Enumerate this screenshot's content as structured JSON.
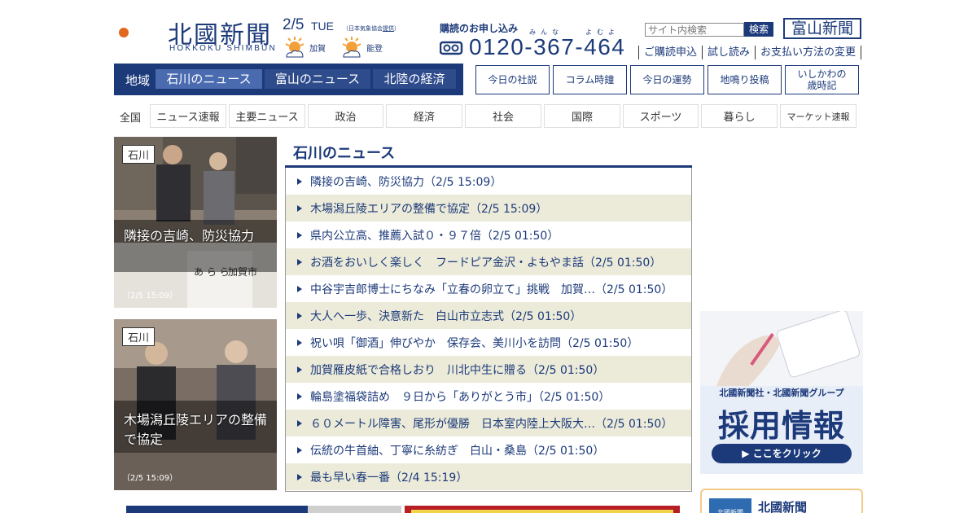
{
  "header": {
    "logo_text": "北國新聞",
    "logo_sub": "HOKKOKU SHIMBUN",
    "date": "2/5",
    "dow": "TUE",
    "weather_source_prefix": "（日本気象協会",
    "weather_source_link": "提供",
    "weather_source_suffix": "）",
    "weather": [
      {
        "area": "加賀",
        "icon": "sun-cloud-icon"
      },
      {
        "area": "能登",
        "icon": "sun-cloud-icon"
      }
    ],
    "subscribe_label": "購読のお申し込み",
    "subscribe_ruby_1": "みんな",
    "subscribe_ruby_2": "よむよ",
    "phone": "0120-367-464",
    "search_placeholder": "サイト内検索",
    "search_button": "検索",
    "toyama_button": "富山新聞",
    "links": [
      "ご購読申込",
      "試し読み",
      "お支払い方法の変更"
    ]
  },
  "nav": {
    "region_label": "地域",
    "region_tabs": [
      "石川のニュース",
      "富山のニュース",
      "北陸の経済"
    ],
    "active_region": "石川のニュース",
    "boxes": [
      "今日の社説",
      "コラム時鐘",
      "今日の運勢",
      "地鳴り投稿",
      "いしかわの\n歳時記"
    ]
  },
  "categories": {
    "all": "全国",
    "items": [
      "ニュース速報",
      "主要ニュース",
      "政治",
      "経済",
      "社会",
      "国際",
      "スポーツ",
      "暮らし",
      "マーケット速報"
    ]
  },
  "featured": [
    {
      "tag": "石川",
      "caption": "隣接の吉崎、防災協力",
      "time": "（2/5 15:09）"
    },
    {
      "tag": "石川",
      "caption": "木場潟丘陵エリアの整備で協定",
      "time": "（2/5 15:09）"
    }
  ],
  "news": {
    "title": "石川のニュース",
    "items": [
      "隣接の吉崎、防災協力（2/5 15:09）",
      "木場潟丘陵エリアの整備で協定（2/5 15:09）",
      "県内公立高、推薦入試０・９７倍（2/5 01:50）",
      "お酒をおいしく楽しく　フードピア金沢・よもやま話（2/5 01:50）",
      "中谷宇吉郎博士にちなみ「立春の卵立て」挑戦　加賀…（2/5 01:50）",
      "大人へ一歩、決意新た　白山市立志式（2/5 01:50）",
      "祝い唄「御酒」伸びやか　保存会、美川小を訪問（2/5 01:50）",
      "加賀雁皮紙で合格しおり　川北中生に贈る（2/5 01:50）",
      "輪島塗福袋詰め　９日から「ありがとう市」（2/5 01:50）",
      "６０メートル障害、尾形が優勝　日本室内陸上大阪大…（2/5 01:50）",
      "伝統の牛首紬、丁寧に糸紡ぎ　白山・桑島（2/5 01:50）",
      "最も早い春一番（2/4 15:19）"
    ]
  },
  "ad": {
    "sub": "北國新聞社・北國新聞グループ",
    "main": "採用情報",
    "button": "▶ ここをクリック"
  },
  "promo": {
    "logo": "北國新聞",
    "text": "北國新聞"
  },
  "colors": {
    "brand": "#1c3a7a",
    "stripe": "#ecebd9"
  }
}
